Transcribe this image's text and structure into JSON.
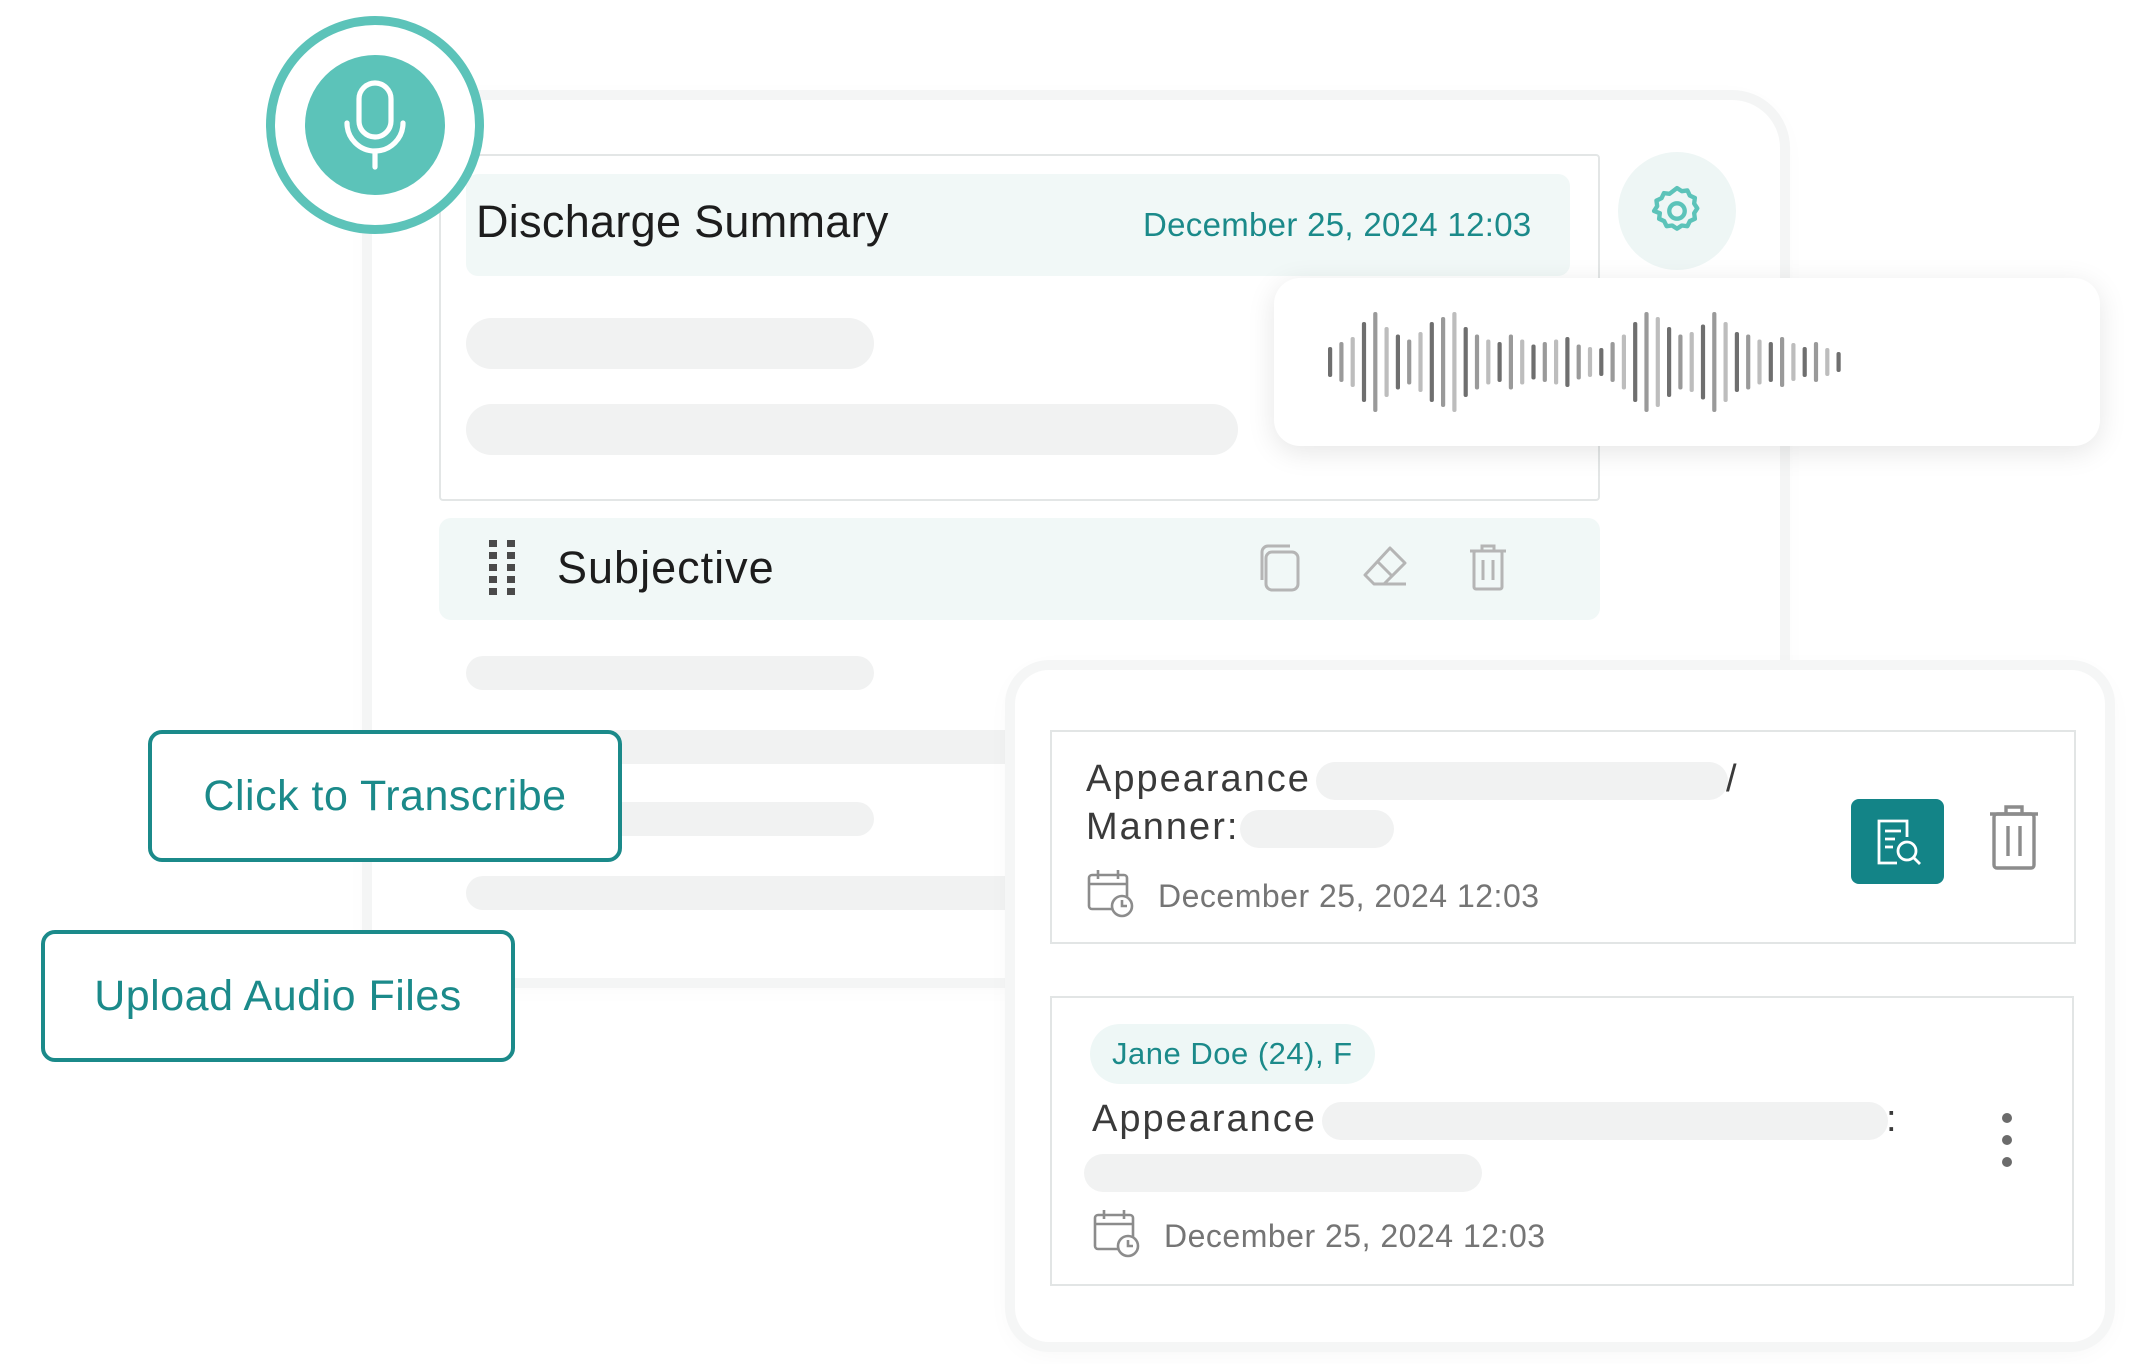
{
  "discharge": {
    "title": "Discharge Summary",
    "date": "December 25, 2024 12:03"
  },
  "section": {
    "title": "Subjective",
    "actions": [
      "copy-icon",
      "eraser-icon",
      "trash-icon"
    ]
  },
  "buttons": {
    "transcribe": "Click to Transcribe",
    "upload": "Upload Audio Files"
  },
  "entries": [
    {
      "line1": "Appearance",
      "sep": "/",
      "line2": "Manner:",
      "date": "December 25, 2024 12:03"
    },
    {
      "patient": "Jane Doe (24), F",
      "line1": "Appearance",
      "colon": ":",
      "date": "December 25, 2024 12:03"
    }
  ],
  "colors": {
    "accent": "#5cc3b9",
    "teal_text": "#1b8a8a",
    "teal_button": "#138487"
  },
  "icons": [
    "microphone-icon",
    "gear-icon",
    "drag-handle-icon",
    "calendar-clock-icon",
    "document-search-icon",
    "more-vertical-icon"
  ]
}
